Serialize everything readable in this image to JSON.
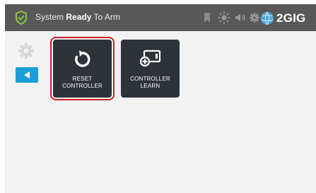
{
  "status_bar": {
    "text_prefix": "System",
    "text_bold": "Ready",
    "text_suffix": "To Arm",
    "brand": "2GIG",
    "icons": [
      "shield-check-icon",
      "bookmark-icon",
      "brightness-icon",
      "volume-icon",
      "gear-icon",
      "globe-icon"
    ]
  },
  "sidebar": {
    "icons": [
      "settings-gear-icon",
      "back-arrow-icon"
    ]
  },
  "tiles": [
    {
      "line1": "RESET",
      "line2": "CONTROLLER",
      "icon": "reset-icon",
      "selected": true
    },
    {
      "line1": "CONTROLLER",
      "line2": "LEARN",
      "icon": "controller-learn-icon",
      "selected": false
    }
  ],
  "colors": {
    "status_bar": "#585858",
    "tile_bg": "#2d3339",
    "accent_blue": "#1a9ed7",
    "selection_red": "#d21f2a",
    "shield_green": "#8dc63f"
  }
}
